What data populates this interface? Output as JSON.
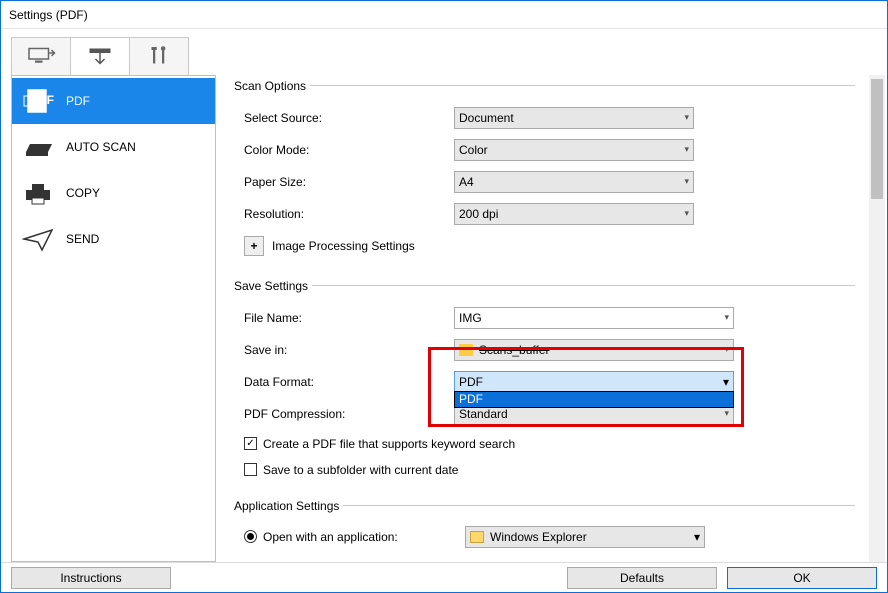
{
  "window": {
    "title": "Settings (PDF)"
  },
  "tabs": {
    "scan": "scan",
    "device": "device",
    "tools": "tools"
  },
  "nav": {
    "items": [
      {
        "label": "PDF"
      },
      {
        "label": "AUTO SCAN"
      },
      {
        "label": "COPY"
      },
      {
        "label": "SEND"
      }
    ]
  },
  "scan_options": {
    "legend": "Scan Options",
    "select_source_label": "Select Source:",
    "select_source_value": "Document",
    "color_mode_label": "Color Mode:",
    "color_mode_value": "Color",
    "paper_size_label": "Paper Size:",
    "paper_size_value": "A4",
    "resolution_label": "Resolution:",
    "resolution_value": "200 dpi",
    "image_processing_label": "Image Processing Settings"
  },
  "save_settings": {
    "legend": "Save Settings",
    "file_name_label": "File Name:",
    "file_name_value": "IMG",
    "save_in_label": "Save in:",
    "save_in_value": "Scans_buffer",
    "data_format_label": "Data Format:",
    "data_format_value": "PDF",
    "data_format_option": "PDF",
    "pdf_compression_label": "PDF Compression:",
    "pdf_compression_value": "Standard",
    "chk_keyword": "Create a PDF file that supports keyword search",
    "chk_subfolder": "Save to a subfolder with current date"
  },
  "app_settings": {
    "legend": "Application Settings",
    "open_with_label": "Open with an application:",
    "open_with_value": "Windows Explorer"
  },
  "footer": {
    "instructions": "Instructions",
    "defaults": "Defaults",
    "ok": "OK"
  }
}
